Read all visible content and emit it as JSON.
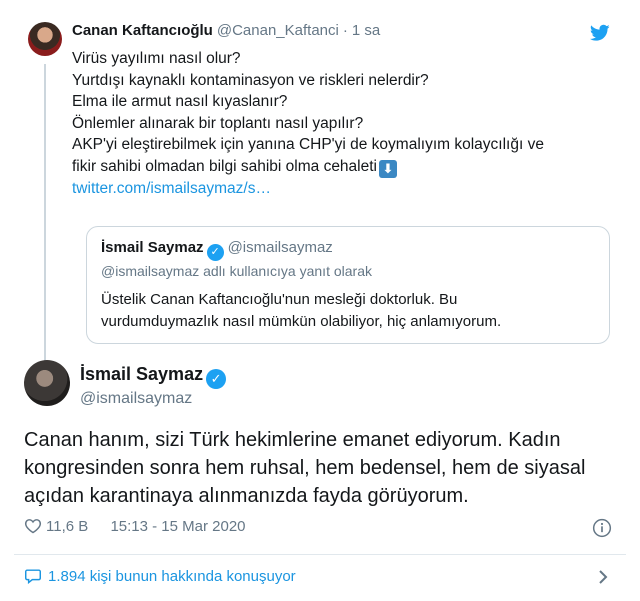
{
  "parent_tweet": {
    "name": "Canan Kaftancıoğlu",
    "handle": "@Canan_Kaftanci",
    "separator": "·",
    "time": "1 sa",
    "lines": [
      "Virüs yayılımı nasıl olur?",
      "Yurtdışı kaynaklı kontaminasyon ve riskleri nelerdir?",
      "Elma ile armut nasıl kıyaslanır?",
      "Önlemler alınarak bir toplantı nasıl yapılır?",
      "AKP'yi eleştirebilmek için yanına CHP'yi de koymalıyım kolaycılığı ve",
      "fikir sahibi olmadan bilgi sahibi olma cehaleti"
    ],
    "emoji": "⬇",
    "link": "twitter.com/ismailsaymaz/s…"
  },
  "quoted_tweet": {
    "name": "İsmail Saymaz",
    "handle": "@ismailsaymaz",
    "reply_context": "@ismailsaymaz adlı kullanıcıya yanıt olarak",
    "lines": [
      "Üstelik Canan Kaftancıoğlu'nun mesleği doktorluk. Bu",
      "vurdumduymazlık nasıl mümkün olabiliyor, hiç anlamıyorum."
    ]
  },
  "main_tweet": {
    "name": "İsmail Saymaz",
    "handle": "@ismailsaymaz",
    "lines": [
      "Canan hanım, sizi Türk hekimlerine emanet ediyorum. Kadın",
      "kongresinden sonra hem ruhsal, hem bedensel, hem de siyasal",
      "açıdan karantinaya alınmanızda fayda görüyorum."
    ],
    "likes": "11,6 B",
    "timestamp": "15:13 - 15 Mar 2020"
  },
  "conversation": {
    "label": "1.894 kişi bunun hakkında konuşuyor"
  },
  "colors": {
    "accent": "#1da1f2",
    "link": "#1b95e0",
    "muted": "#657786",
    "border": "#ccd6dd"
  },
  "icons": {
    "bird": "twitter-bird-icon",
    "verified": "verified-badge-icon",
    "heart": "heart-icon",
    "info": "info-icon",
    "bubble": "speech-bubble-icon",
    "chevron": "chevron-right-icon"
  }
}
